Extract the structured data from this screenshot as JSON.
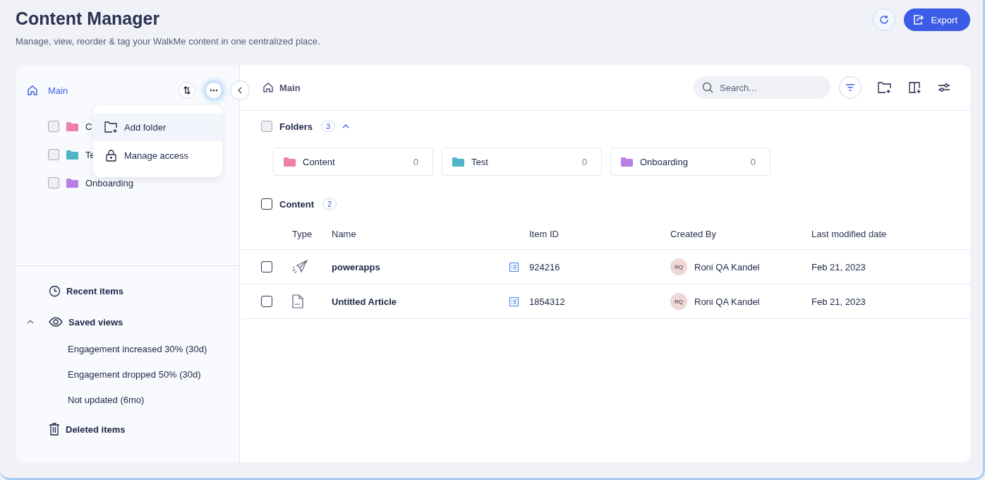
{
  "header": {
    "title": "Content Manager",
    "subtitle": "Manage, view, reorder & tag your WalkMe content in one centralized place.",
    "export_label": "Export"
  },
  "sidebar": {
    "root": {
      "label": "Main",
      "selected": true
    },
    "tree": [
      {
        "label": "C",
        "color": "#ef80a8",
        "checked": false
      },
      {
        "label": "Te",
        "color": "#4fb4c7",
        "checked": false
      },
      {
        "label": "Onboarding",
        "color": "#b880e6",
        "checked": false
      }
    ],
    "menu": [
      {
        "kind": "add-folder",
        "label": "Add folder",
        "selected": true
      },
      {
        "kind": "lock",
        "label": "Manage access",
        "selected": false
      }
    ],
    "nav": [
      {
        "kind": "recent",
        "label": "Recent items"
      },
      {
        "kind": "saved",
        "label": "Saved views",
        "expanded": true,
        "children": [
          {
            "label": "Engagement increased 30% (30d)"
          },
          {
            "label": "Engagement dropped 50% (30d)"
          },
          {
            "label": "Not updated (6mo)"
          }
        ]
      },
      {
        "kind": "deleted",
        "label": "Deleted items"
      }
    ]
  },
  "main": {
    "breadcrumb": "Main",
    "search": {
      "placeholder": "Search..."
    },
    "folders": {
      "label": "Folders",
      "count": "3",
      "expanded": true,
      "checked": false,
      "items": [
        {
          "label": "Content",
          "count": "0",
          "color": "#ef80a8"
        },
        {
          "label": "Test",
          "count": "0",
          "color": "#4fb4c7"
        },
        {
          "label": "Onboarding",
          "count": "0",
          "color": "#b880e6"
        }
      ]
    },
    "content": {
      "label": "Content",
      "count": "2",
      "checked": false
    },
    "table": {
      "columns": [
        "Type",
        "Name",
        "Item ID",
        "Created By",
        "Last modified date"
      ],
      "rows": [
        {
          "kind": "flow",
          "checked": false,
          "name": "powerapps",
          "item_id": "924216",
          "initials": "RQ",
          "created_by": "Roni QA Kandel",
          "date": "Feb 21, 2023"
        },
        {
          "kind": "article",
          "checked": false,
          "name": "Untitled Article",
          "item_id": "1854312",
          "initials": "RQ",
          "created_by": "Roni QA Kandel",
          "date": "Feb 21, 2023"
        }
      ]
    }
  }
}
